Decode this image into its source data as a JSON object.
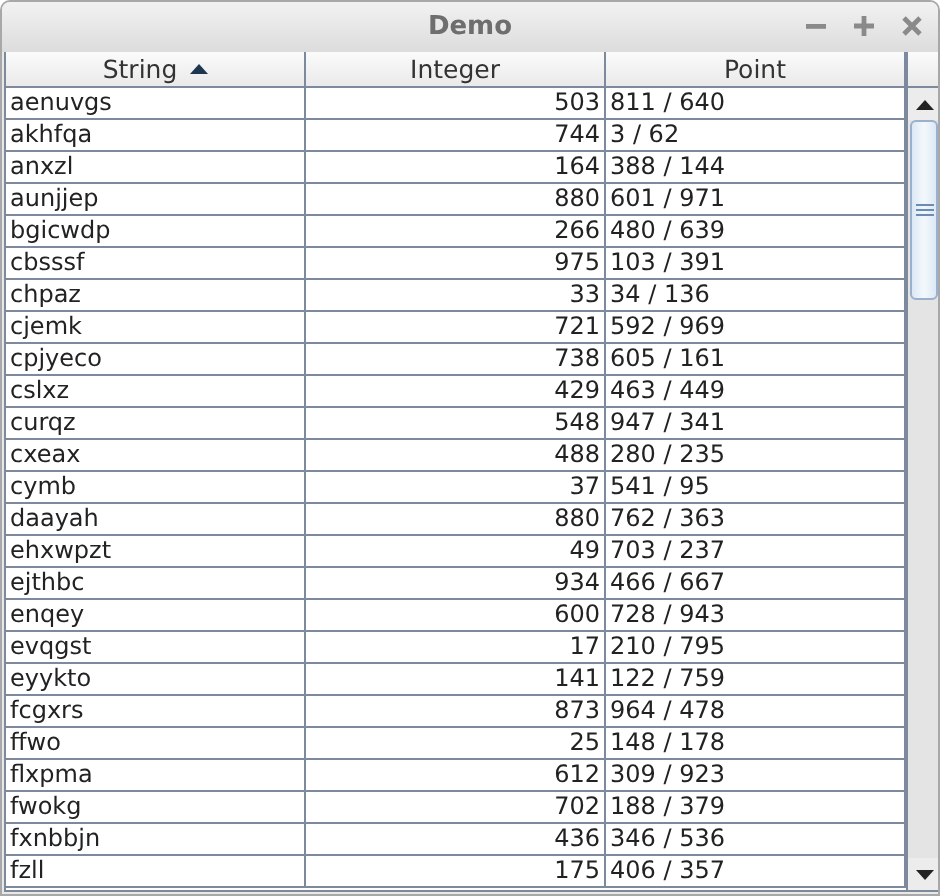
{
  "window": {
    "title": "Demo"
  },
  "table": {
    "columns": [
      {
        "label": "String",
        "sorted": true,
        "numeric": false
      },
      {
        "label": "Integer",
        "sorted": false,
        "numeric": true
      },
      {
        "label": "Point",
        "sorted": false,
        "numeric": false
      }
    ],
    "rows": [
      [
        "aenuvgs",
        "503",
        "811 / 640"
      ],
      [
        "akhfqa",
        "744",
        "3 / 62"
      ],
      [
        "anxzl",
        "164",
        "388 / 144"
      ],
      [
        "aunjjep",
        "880",
        "601 / 971"
      ],
      [
        "bgicwdp",
        "266",
        "480 / 639"
      ],
      [
        "cbsssf",
        "975",
        "103 / 391"
      ],
      [
        "chpaz",
        "33",
        "34 / 136"
      ],
      [
        "cjemk",
        "721",
        "592 / 969"
      ],
      [
        "cpjyeco",
        "738",
        "605 / 161"
      ],
      [
        "cslxz",
        "429",
        "463 / 449"
      ],
      [
        "curqz",
        "548",
        "947 / 341"
      ],
      [
        "cxeax",
        "488",
        "280 / 235"
      ],
      [
        "cymb",
        "37",
        "541 / 95"
      ],
      [
        "daayah",
        "880",
        "762 / 363"
      ],
      [
        "ehxwpzt",
        "49",
        "703 / 237"
      ],
      [
        "ejthbc",
        "934",
        "466 / 667"
      ],
      [
        "enqey",
        "600",
        "728 / 943"
      ],
      [
        "evqgst",
        "17",
        "210 / 795"
      ],
      [
        "eyykto",
        "141",
        "122 / 759"
      ],
      [
        "fcgxrs",
        "873",
        "964 / 478"
      ],
      [
        "ffwo",
        "25",
        "148 / 178"
      ],
      [
        "flxpma",
        "612",
        "309 / 923"
      ],
      [
        "fwokg",
        "702",
        "188 / 379"
      ],
      [
        "fxnbbjn",
        "436",
        "346 / 536"
      ],
      [
        "fzll",
        "175",
        "406 / 357"
      ]
    ]
  }
}
